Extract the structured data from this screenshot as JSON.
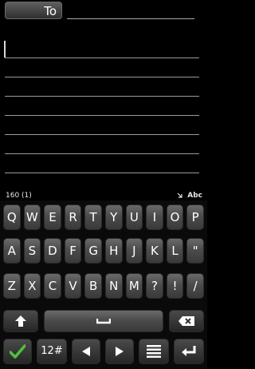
{
  "header": {
    "to_label": "To"
  },
  "status": {
    "char_counter": "160 (1)",
    "input_mode": "Abc"
  },
  "keyboard": {
    "row1": [
      "Q",
      "W",
      "E",
      "R",
      "T",
      "Y",
      "U",
      "I",
      "O",
      "P"
    ],
    "row2": [
      "A",
      "S",
      "D",
      "F",
      "G",
      "H",
      "J",
      "K",
      "L",
      "\""
    ],
    "row3": [
      "Z",
      "X",
      "C",
      "V",
      "B",
      "N",
      "M",
      "?",
      "!",
      "/"
    ],
    "numeric_label": "12#"
  },
  "icons": {
    "shift": "shift-arrow-icon",
    "space": "space-bar-icon",
    "backspace": "backspace-icon",
    "confirm": "checkmark-icon",
    "left": "arrow-left-icon",
    "right": "arrow-right-icon",
    "menu": "menu-list-icon",
    "enter": "enter-return-icon"
  },
  "colors": {
    "confirm_green": "#4fc23a",
    "background": "#000000"
  }
}
